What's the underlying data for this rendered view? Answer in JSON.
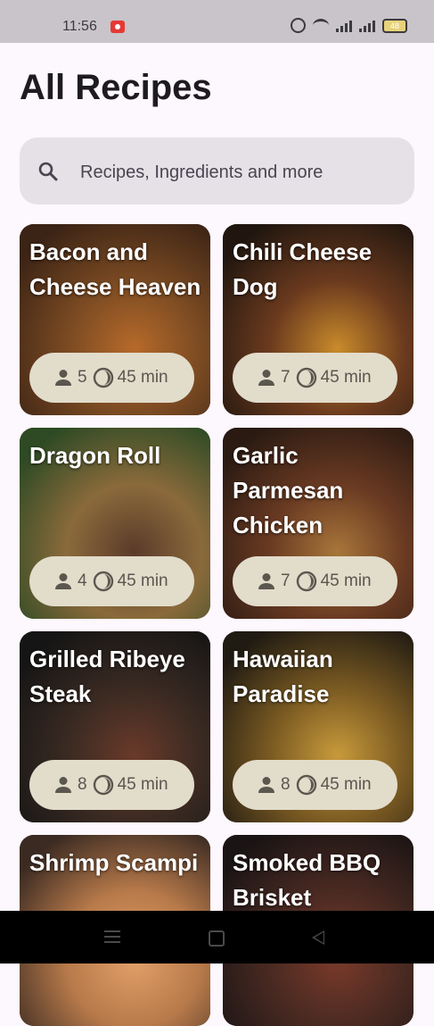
{
  "status_bar": {
    "time": "11:56",
    "battery": "48"
  },
  "page_title": "All Recipes",
  "search": {
    "placeholder": "Recipes, Ingredients and more"
  },
  "recipes": [
    {
      "name": "Bacon and Cheese Heaven",
      "servings": "5",
      "time": "45 min",
      "colors": [
        "#3b2315",
        "#7a4a22",
        "#b66a2a"
      ]
    },
    {
      "name": "Chili Cheese Dog",
      "servings": "7",
      "time": "45 min",
      "colors": [
        "#20160f",
        "#6b3a1e",
        "#c98b2b"
      ]
    },
    {
      "name": "Dragon Roll",
      "servings": "4",
      "time": "45 min",
      "colors": [
        "#2d4a24",
        "#8a6a3b",
        "#5b3a2a"
      ]
    },
    {
      "name": "Garlic Parmesan Chicken",
      "servings": "7",
      "time": "45 min",
      "colors": [
        "#2a1a12",
        "#6a3a22",
        "#a8763a"
      ]
    },
    {
      "name": "Grilled Ribeye Steak",
      "servings": "8",
      "time": "45 min",
      "colors": [
        "#151515",
        "#3a2a22",
        "#6a3a2a"
      ]
    },
    {
      "name": "Hawaiian Paradise",
      "servings": "8",
      "time": "45 min",
      "colors": [
        "#1f1a12",
        "#7a5a22",
        "#c89a3b"
      ]
    },
    {
      "name": "Shrimp Scampi",
      "servings": "",
      "time": "",
      "colors": [
        "#3a2a22",
        "#b87a4a",
        "#e2a06a"
      ]
    },
    {
      "name": "Smoked BBQ Brisket",
      "servings": "",
      "time": "",
      "colors": [
        "#1a1414",
        "#4a2a22",
        "#7a3a2a"
      ]
    }
  ]
}
